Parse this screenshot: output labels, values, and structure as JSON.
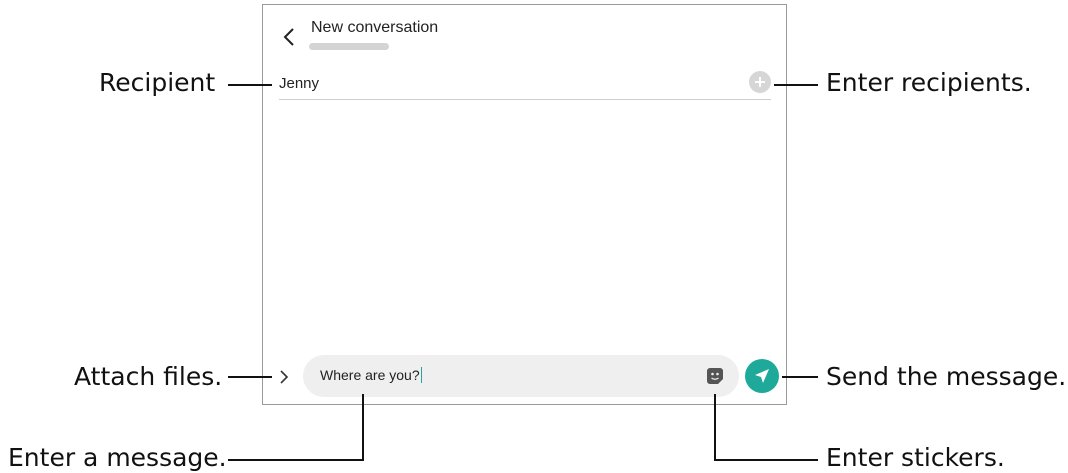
{
  "screen": {
    "title": "New conversation",
    "recipient": "Jenny",
    "message_text": "Where are you?"
  },
  "callouts": {
    "recipient": "Recipient",
    "enter_recipients": "Enter recipients.",
    "attach_files": "Attach files.",
    "send_message": "Send the message.",
    "enter_message": "Enter a message.",
    "enter_stickers": "Enter stickers."
  },
  "icons": {
    "back": "chevron-left-icon",
    "add_recipient": "plus-circle-icon",
    "attach": "chevron-right-icon",
    "sticker": "sticker-icon",
    "send": "paper-plane-icon"
  },
  "colors": {
    "accent": "#1fa99a",
    "field_background": "#efefef",
    "add_button": "#d6d6d6"
  }
}
